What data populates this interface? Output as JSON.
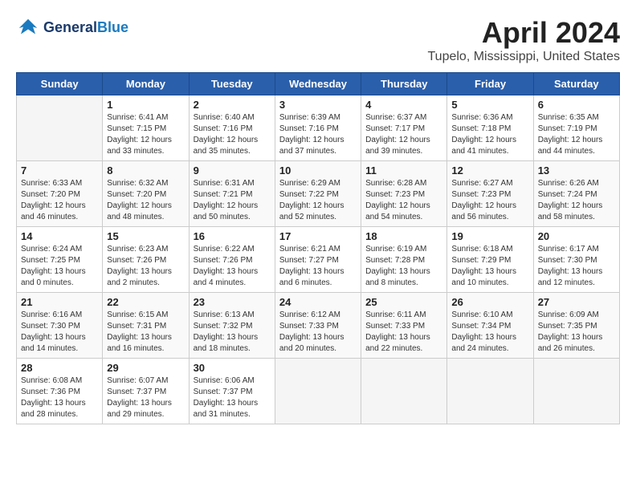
{
  "header": {
    "logo_general": "General",
    "logo_blue": "Blue",
    "title": "April 2024",
    "subtitle": "Tupelo, Mississippi, United States"
  },
  "calendar": {
    "weekdays": [
      "Sunday",
      "Monday",
      "Tuesday",
      "Wednesday",
      "Thursday",
      "Friday",
      "Saturday"
    ],
    "weeks": [
      [
        {
          "day": "",
          "info": ""
        },
        {
          "day": "1",
          "info": "Sunrise: 6:41 AM\nSunset: 7:15 PM\nDaylight: 12 hours\nand 33 minutes."
        },
        {
          "day": "2",
          "info": "Sunrise: 6:40 AM\nSunset: 7:16 PM\nDaylight: 12 hours\nand 35 minutes."
        },
        {
          "day": "3",
          "info": "Sunrise: 6:39 AM\nSunset: 7:16 PM\nDaylight: 12 hours\nand 37 minutes."
        },
        {
          "day": "4",
          "info": "Sunrise: 6:37 AM\nSunset: 7:17 PM\nDaylight: 12 hours\nand 39 minutes."
        },
        {
          "day": "5",
          "info": "Sunrise: 6:36 AM\nSunset: 7:18 PM\nDaylight: 12 hours\nand 41 minutes."
        },
        {
          "day": "6",
          "info": "Sunrise: 6:35 AM\nSunset: 7:19 PM\nDaylight: 12 hours\nand 44 minutes."
        }
      ],
      [
        {
          "day": "7",
          "info": "Sunrise: 6:33 AM\nSunset: 7:20 PM\nDaylight: 12 hours\nand 46 minutes."
        },
        {
          "day": "8",
          "info": "Sunrise: 6:32 AM\nSunset: 7:20 PM\nDaylight: 12 hours\nand 48 minutes."
        },
        {
          "day": "9",
          "info": "Sunrise: 6:31 AM\nSunset: 7:21 PM\nDaylight: 12 hours\nand 50 minutes."
        },
        {
          "day": "10",
          "info": "Sunrise: 6:29 AM\nSunset: 7:22 PM\nDaylight: 12 hours\nand 52 minutes."
        },
        {
          "day": "11",
          "info": "Sunrise: 6:28 AM\nSunset: 7:23 PM\nDaylight: 12 hours\nand 54 minutes."
        },
        {
          "day": "12",
          "info": "Sunrise: 6:27 AM\nSunset: 7:23 PM\nDaylight: 12 hours\nand 56 minutes."
        },
        {
          "day": "13",
          "info": "Sunrise: 6:26 AM\nSunset: 7:24 PM\nDaylight: 12 hours\nand 58 minutes."
        }
      ],
      [
        {
          "day": "14",
          "info": "Sunrise: 6:24 AM\nSunset: 7:25 PM\nDaylight: 13 hours\nand 0 minutes."
        },
        {
          "day": "15",
          "info": "Sunrise: 6:23 AM\nSunset: 7:26 PM\nDaylight: 13 hours\nand 2 minutes."
        },
        {
          "day": "16",
          "info": "Sunrise: 6:22 AM\nSunset: 7:26 PM\nDaylight: 13 hours\nand 4 minutes."
        },
        {
          "day": "17",
          "info": "Sunrise: 6:21 AM\nSunset: 7:27 PM\nDaylight: 13 hours\nand 6 minutes."
        },
        {
          "day": "18",
          "info": "Sunrise: 6:19 AM\nSunset: 7:28 PM\nDaylight: 13 hours\nand 8 minutes."
        },
        {
          "day": "19",
          "info": "Sunrise: 6:18 AM\nSunset: 7:29 PM\nDaylight: 13 hours\nand 10 minutes."
        },
        {
          "day": "20",
          "info": "Sunrise: 6:17 AM\nSunset: 7:30 PM\nDaylight: 13 hours\nand 12 minutes."
        }
      ],
      [
        {
          "day": "21",
          "info": "Sunrise: 6:16 AM\nSunset: 7:30 PM\nDaylight: 13 hours\nand 14 minutes."
        },
        {
          "day": "22",
          "info": "Sunrise: 6:15 AM\nSunset: 7:31 PM\nDaylight: 13 hours\nand 16 minutes."
        },
        {
          "day": "23",
          "info": "Sunrise: 6:13 AM\nSunset: 7:32 PM\nDaylight: 13 hours\nand 18 minutes."
        },
        {
          "day": "24",
          "info": "Sunrise: 6:12 AM\nSunset: 7:33 PM\nDaylight: 13 hours\nand 20 minutes."
        },
        {
          "day": "25",
          "info": "Sunrise: 6:11 AM\nSunset: 7:33 PM\nDaylight: 13 hours\nand 22 minutes."
        },
        {
          "day": "26",
          "info": "Sunrise: 6:10 AM\nSunset: 7:34 PM\nDaylight: 13 hours\nand 24 minutes."
        },
        {
          "day": "27",
          "info": "Sunrise: 6:09 AM\nSunset: 7:35 PM\nDaylight: 13 hours\nand 26 minutes."
        }
      ],
      [
        {
          "day": "28",
          "info": "Sunrise: 6:08 AM\nSunset: 7:36 PM\nDaylight: 13 hours\nand 28 minutes."
        },
        {
          "day": "29",
          "info": "Sunrise: 6:07 AM\nSunset: 7:37 PM\nDaylight: 13 hours\nand 29 minutes."
        },
        {
          "day": "30",
          "info": "Sunrise: 6:06 AM\nSunset: 7:37 PM\nDaylight: 13 hours\nand 31 minutes."
        },
        {
          "day": "",
          "info": ""
        },
        {
          "day": "",
          "info": ""
        },
        {
          "day": "",
          "info": ""
        },
        {
          "day": "",
          "info": ""
        }
      ]
    ]
  }
}
